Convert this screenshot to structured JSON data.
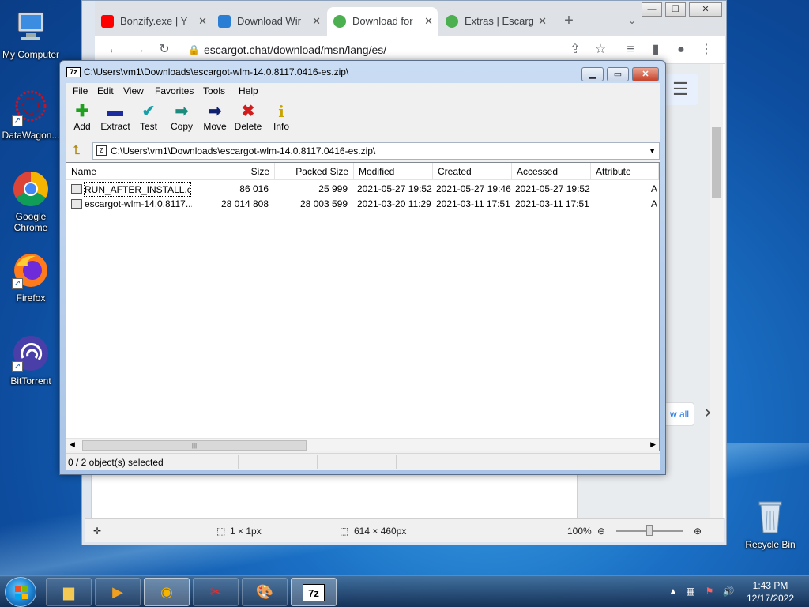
{
  "desktop": {
    "icons": [
      {
        "label": "My Computer"
      },
      {
        "label": "DataWagon..."
      },
      {
        "label": "Google Chrome"
      },
      {
        "label": "Firefox"
      },
      {
        "label": "BitTorrent"
      },
      {
        "label": "Recycle Bin"
      }
    ]
  },
  "browser": {
    "tabs": [
      {
        "label": "Bonzify.exe | Y",
        "color": "#ff0000"
      },
      {
        "label": "Download Wir",
        "color": "#2a7fd4"
      },
      {
        "label": "Download for",
        "color": "#4caf50"
      },
      {
        "label": "Extras | Escarg",
        "color": "#4caf50"
      }
    ],
    "url": "escargot.chat/download/msn/lang/es/",
    "download_bar": {
      "view_all": "w all"
    },
    "status": {
      "dims_selection": "1 × 1px",
      "dims_image": "614 × 460px",
      "zoom": "100%"
    }
  },
  "sevenzip": {
    "title": "C:\\Users\\vm1\\Downloads\\escargot-wlm-14.0.8117.0416-es.zip\\",
    "app_icon": "7z",
    "menu": [
      "File",
      "Edit",
      "View",
      "Favorites",
      "Tools",
      "Help"
    ],
    "tools": [
      {
        "label": "Add",
        "glyph": "✚",
        "color": "#1fa01f"
      },
      {
        "label": "Extract",
        "glyph": "▬",
        "color": "#1c2b9e"
      },
      {
        "label": "Test",
        "glyph": "✔",
        "color": "#16a0a8"
      },
      {
        "label": "Copy",
        "glyph": "➡",
        "color": "#1b8c7e"
      },
      {
        "label": "Move",
        "glyph": "➡",
        "color": "#102070"
      },
      {
        "label": "Delete",
        "glyph": "✖",
        "color": "#d21c1c"
      },
      {
        "label": "Info",
        "glyph": "i",
        "color": "#c9a400"
      }
    ],
    "path": "C:\\Users\\vm1\\Downloads\\escargot-wlm-14.0.8117.0416-es.zip\\",
    "columns": [
      "Name",
      "Size",
      "Packed Size",
      "Modified",
      "Created",
      "Accessed",
      "Attribute"
    ],
    "rows": [
      {
        "name": "RUN_AFTER_INSTALL.exe",
        "size": "86 016",
        "packed": "25 999",
        "modified": "2021-05-27 19:52",
        "created": "2021-05-27 19:46",
        "accessed": "2021-05-27 19:52",
        "attr": "A"
      },
      {
        "name": "escargot-wlm-14.0.8117...",
        "size": "28 014 808",
        "packed": "28 003 599",
        "modified": "2021-03-20 11:29",
        "created": "2021-03-11 17:51",
        "accessed": "2021-03-11 17:51",
        "attr": "A"
      }
    ],
    "status": "0 / 2 object(s) selected"
  },
  "taskbar": {
    "clock_time": "1:43 PM",
    "clock_date": "12/17/2022"
  }
}
